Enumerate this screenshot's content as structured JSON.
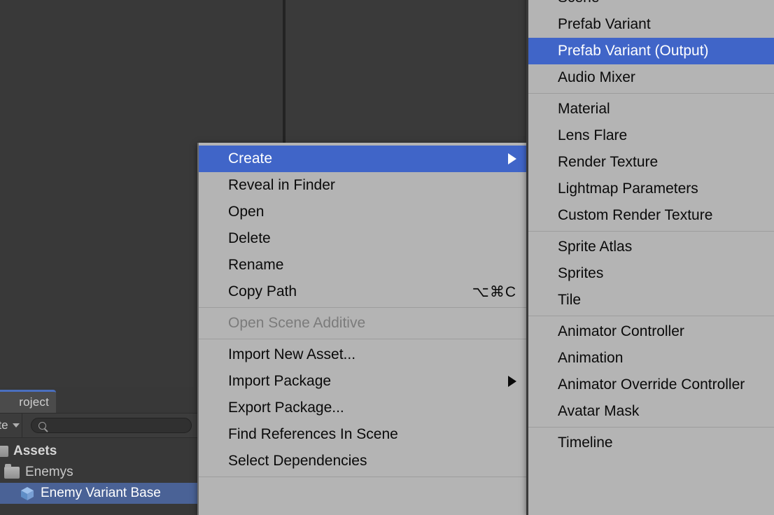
{
  "editor": {
    "background_color": "#383838",
    "accent_blue": "#4065c8",
    "menu_background": "#b4b4b4",
    "selection_blue": "#4a6296"
  },
  "project_panel": {
    "tab_label": "roject",
    "tab_label_full": "Project",
    "create_button_label": "ate",
    "create_button_label_full": "Create",
    "search_placeholder": "",
    "search_value": "",
    "tree": [
      {
        "label": "Assets",
        "icon": "assets-icon",
        "indent": 1,
        "selected": false,
        "bold": true
      },
      {
        "label": "Enemys",
        "icon": "folder-icon",
        "indent": 1,
        "selected": false,
        "bold": false
      },
      {
        "label": "Enemy Variant Base",
        "icon": "prefab-cube-icon",
        "indent": 2,
        "selected": true,
        "bold": false
      }
    ]
  },
  "context_menu": {
    "name": "asset-context-menu",
    "groups": [
      {
        "items": [
          {
            "label": "Create",
            "highlighted": true,
            "submenu": true,
            "shortcut": "",
            "disabled": false
          },
          {
            "label": "Reveal in Finder",
            "highlighted": false,
            "submenu": false,
            "shortcut": "",
            "disabled": false
          },
          {
            "label": "Open",
            "highlighted": false,
            "submenu": false,
            "shortcut": "",
            "disabled": false
          },
          {
            "label": "Delete",
            "highlighted": false,
            "submenu": false,
            "shortcut": "",
            "disabled": false
          },
          {
            "label": "Rename",
            "highlighted": false,
            "submenu": false,
            "shortcut": "",
            "disabled": false
          },
          {
            "label": "Copy Path",
            "highlighted": false,
            "submenu": false,
            "shortcut": "⌥⌘C",
            "disabled": false
          }
        ]
      },
      {
        "items": [
          {
            "label": "Open Scene Additive",
            "highlighted": false,
            "submenu": false,
            "shortcut": "",
            "disabled": true
          }
        ]
      },
      {
        "items": [
          {
            "label": "Import New Asset...",
            "highlighted": false,
            "submenu": false,
            "shortcut": "",
            "disabled": false
          },
          {
            "label": "Import Package",
            "highlighted": false,
            "submenu": true,
            "shortcut": "",
            "disabled": false
          },
          {
            "label": "Export Package...",
            "highlighted": false,
            "submenu": false,
            "shortcut": "",
            "disabled": false
          },
          {
            "label": "Find References In Scene",
            "highlighted": false,
            "submenu": false,
            "shortcut": "",
            "disabled": false
          },
          {
            "label": "Select Dependencies",
            "highlighted": false,
            "submenu": false,
            "shortcut": "",
            "disabled": false
          }
        ]
      }
    ]
  },
  "create_submenu": {
    "name": "create-submenu",
    "groups": [
      {
        "items": [
          {
            "label": "Scene",
            "highlighted": false,
            "clipped_top": true
          },
          {
            "label": "Prefab Variant",
            "highlighted": false
          },
          {
            "label": "Prefab Variant (Output)",
            "highlighted": true
          },
          {
            "label": "Audio Mixer",
            "highlighted": false
          }
        ]
      },
      {
        "items": [
          {
            "label": "Material",
            "highlighted": false
          },
          {
            "label": "Lens Flare",
            "highlighted": false
          },
          {
            "label": "Render Texture",
            "highlighted": false
          },
          {
            "label": "Lightmap Parameters",
            "highlighted": false
          },
          {
            "label": "Custom Render Texture",
            "highlighted": false
          }
        ]
      },
      {
        "items": [
          {
            "label": "Sprite Atlas",
            "highlighted": false
          },
          {
            "label": "Sprites",
            "highlighted": false
          },
          {
            "label": "Tile",
            "highlighted": false
          }
        ]
      },
      {
        "items": [
          {
            "label": "Animator Controller",
            "highlighted": false
          },
          {
            "label": "Animation",
            "highlighted": false
          },
          {
            "label": "Animator Override Controller",
            "highlighted": false
          },
          {
            "label": "Avatar Mask",
            "highlighted": false
          }
        ]
      },
      {
        "items": [
          {
            "label": "Timeline",
            "highlighted": false
          }
        ]
      }
    ]
  }
}
